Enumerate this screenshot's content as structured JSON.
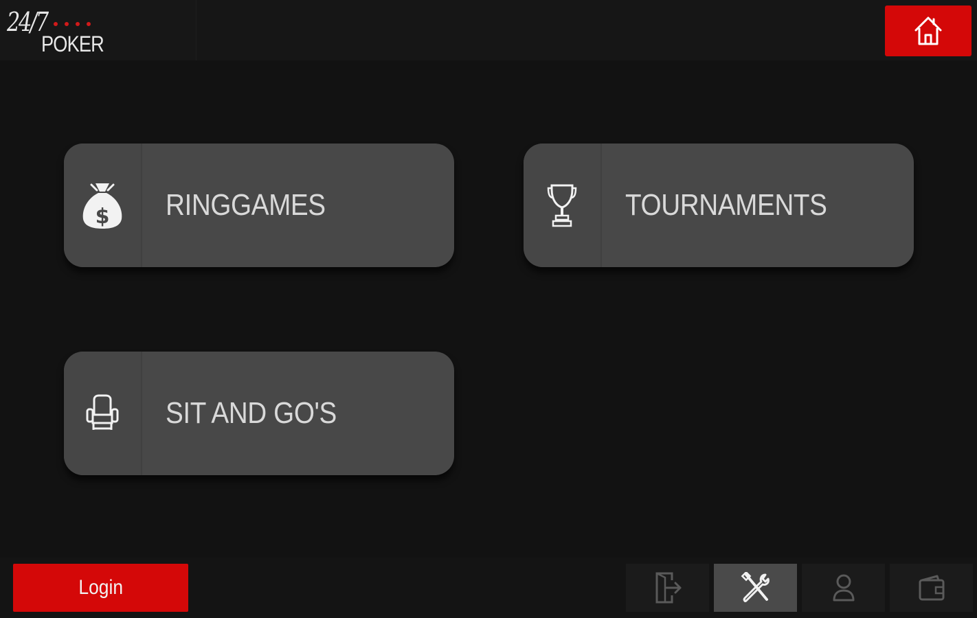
{
  "header": {
    "logo": {
      "numeral": "24/7",
      "word": "POKER"
    },
    "home_icon": "home-icon",
    "colors": {
      "accent": "#d40808",
      "background": "#121212"
    }
  },
  "main": {
    "tiles": [
      {
        "label": "RINGGAMES",
        "icon": "money-bag-icon"
      },
      {
        "label": "TOURNAMENTS",
        "icon": "trophy-icon"
      },
      {
        "label": "SIT AND GO'S",
        "icon": "chair-icon"
      }
    ]
  },
  "footer": {
    "login_label": "Login",
    "buttons": [
      {
        "icon": "logout-icon"
      },
      {
        "icon": "tools-icon",
        "active": true
      },
      {
        "icon": "user-icon"
      },
      {
        "icon": "wallet-icon"
      }
    ]
  }
}
